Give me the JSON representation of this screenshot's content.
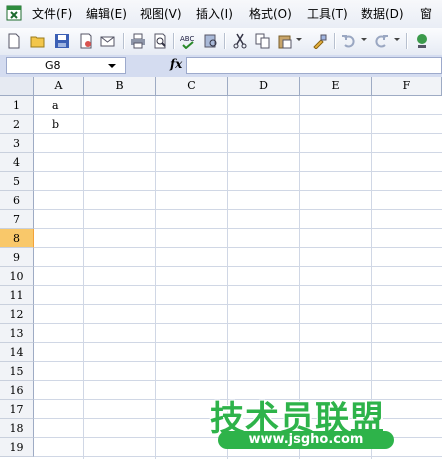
{
  "menu": [
    "文件(F)",
    "编辑(E)",
    "视图(V)",
    "插入(I)",
    "格式(O)",
    "工具(T)",
    "数据(D)",
    "窗"
  ],
  "toolbar": {
    "icons": [
      "new-icon",
      "open-icon",
      "save-icon",
      "permission-icon",
      "email-icon",
      "print-icon",
      "print-preview-icon",
      "spelling-icon",
      "research-icon",
      "cut-icon",
      "copy-icon",
      "paste-icon",
      "format-painter-icon",
      "undo-icon",
      "redo-icon",
      "hyperlink-icon"
    ]
  },
  "formula_bar": {
    "name_box": "G8",
    "fx": "fx",
    "formula": ""
  },
  "columns": [
    "A",
    "B",
    "C",
    "D",
    "E",
    "F"
  ],
  "rows": [
    "1",
    "2",
    "3",
    "4",
    "5",
    "6",
    "7",
    "8",
    "9",
    "10",
    "11",
    "12",
    "13",
    "14",
    "15",
    "16",
    "17",
    "18",
    "19"
  ],
  "active_row": "8",
  "cells": {
    "A1": "a",
    "A2": "b"
  },
  "watermark": {
    "title": "技术员联盟",
    "url": "www.jsgho.com"
  },
  "colors": {
    "header_bg": "#f1f3f7",
    "active_row": "#f9c86a",
    "watermark_green": "#2eb34a"
  }
}
